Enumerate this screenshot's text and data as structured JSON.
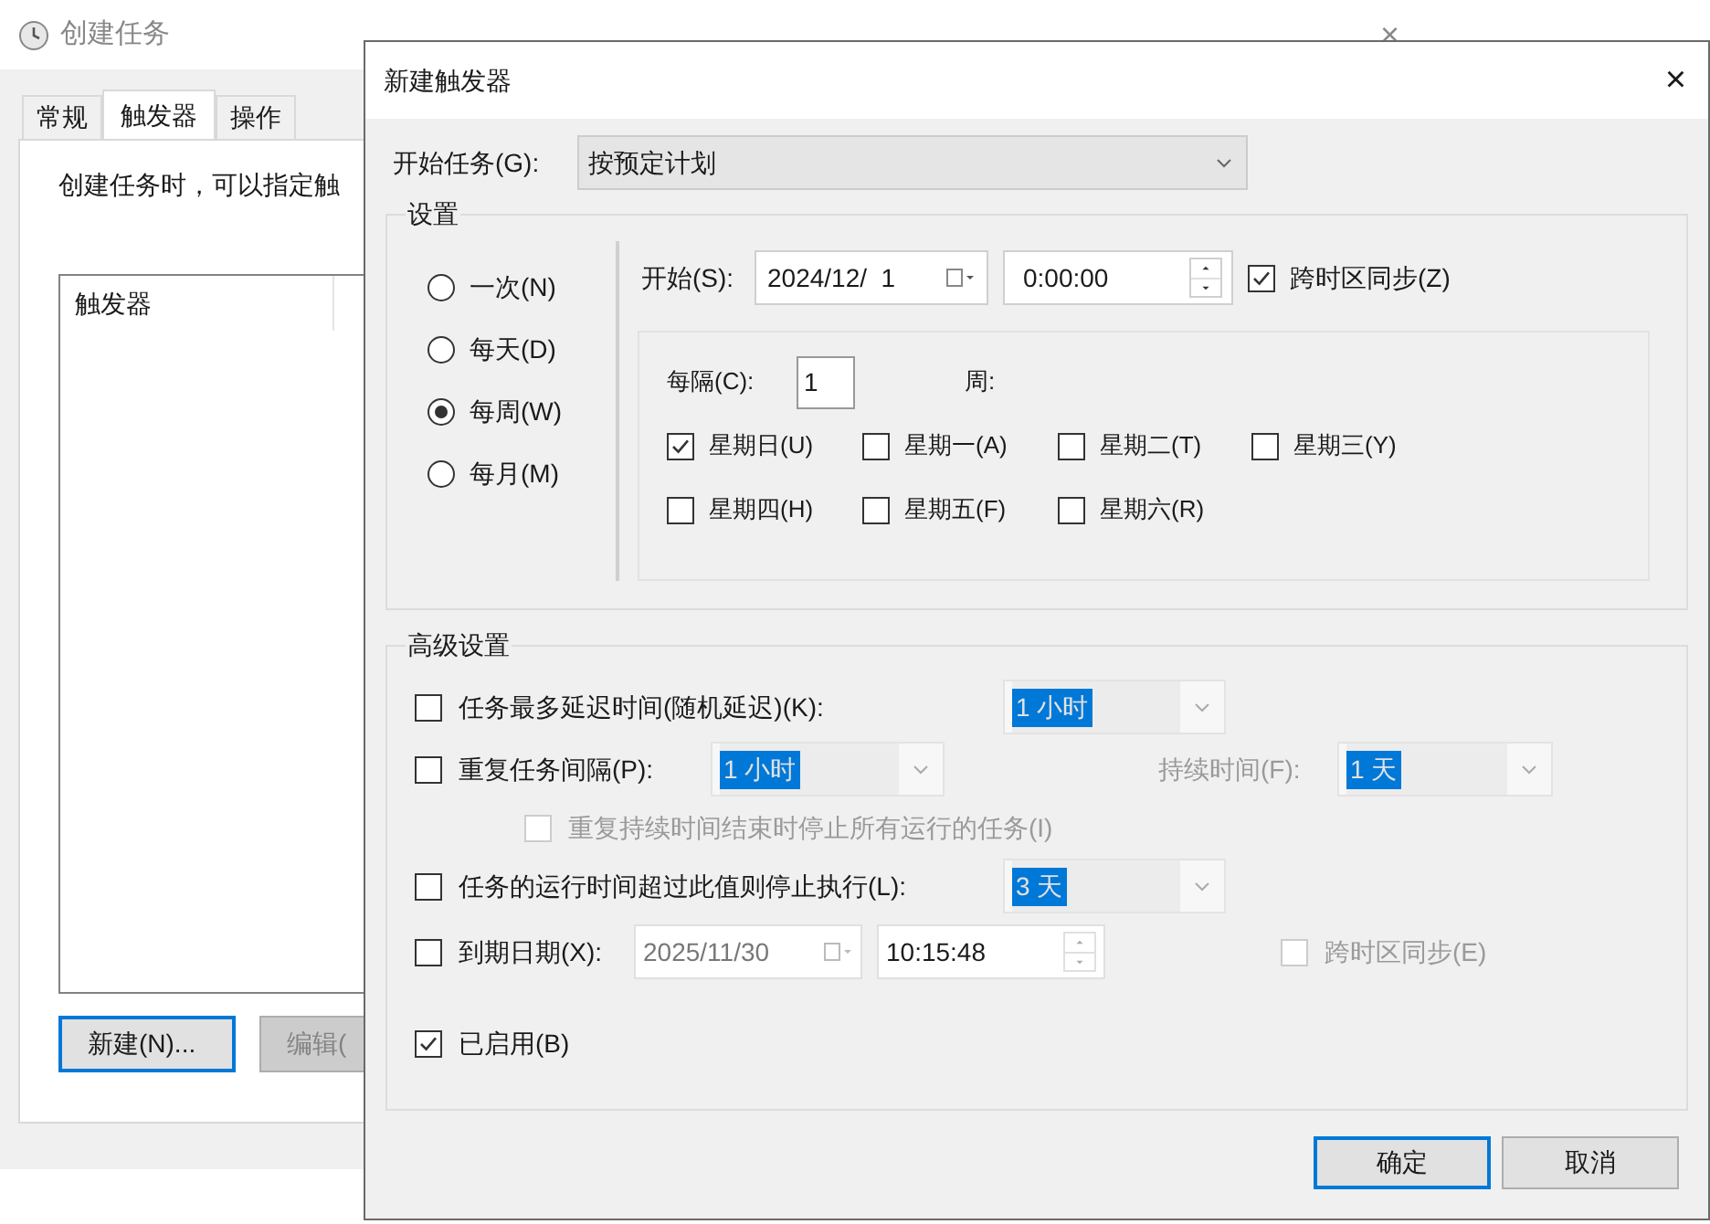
{
  "background_window": {
    "title": "创建任务",
    "close": "×",
    "tabs": [
      {
        "label": "常规",
        "selected": false
      },
      {
        "label": "触发器",
        "selected": true
      },
      {
        "label": "操作",
        "selected": false
      }
    ],
    "description": "创建任务时，可以指定触",
    "table": {
      "columns": [
        "触发器"
      ]
    },
    "buttons": [
      {
        "label": "新建(N)...",
        "disabled": false,
        "focused": true
      },
      {
        "label": "编辑(",
        "disabled": true,
        "focused": false
      }
    ]
  },
  "dialog": {
    "title": "新建触发器",
    "close": "×",
    "start_task": {
      "label": "开始任务(G):",
      "value": "按预定计划"
    },
    "settings": {
      "title": "设置",
      "schedule_options": [
        {
          "label": "一次(N)",
          "selected": false
        },
        {
          "label": "每天(D)",
          "selected": false
        },
        {
          "label": "每周(W)",
          "selected": true
        },
        {
          "label": "每月(M)",
          "selected": false
        }
      ],
      "start": {
        "label": "开始(S):",
        "date": "2024/12/  1",
        "time": "0:00:00",
        "sync": {
          "label": "跨时区同步(Z)",
          "checked": true
        }
      },
      "recur": {
        "label": "每隔(C):",
        "value": "1",
        "unit": "周:"
      },
      "days": [
        {
          "label": "星期日(U)",
          "checked": true
        },
        {
          "label": "星期一(A)",
          "checked": false
        },
        {
          "label": "星期二(T)",
          "checked": false
        },
        {
          "label": "星期三(Y)",
          "checked": false
        },
        {
          "label": "星期四(H)",
          "checked": false
        },
        {
          "label": "星期五(F)",
          "checked": false
        },
        {
          "label": "星期六(R)",
          "checked": false
        }
      ]
    },
    "advanced": {
      "title": "高级设置",
      "rows": [
        {
          "kind": "select",
          "label": "任务最多延迟时间(随机延迟)(K):",
          "checked": false,
          "value": "1 小时",
          "disabled": true
        },
        {
          "kind": "repeat",
          "label": "重复任务间隔(P):",
          "checked": false,
          "value": "1 小时",
          "disabled": true,
          "duration": {
            "label": "持续时间(F):",
            "value": "1 天"
          }
        },
        {
          "kind": "sub",
          "label": "重复持续时间结束时停止所有运行的任务(I)",
          "checked": false,
          "disabled": true
        },
        {
          "kind": "select",
          "label": "任务的运行时间超过此值则停止执行(L):",
          "checked": false,
          "value": "3 天",
          "disabled": true
        },
        {
          "kind": "expire",
          "label": "到期日期(X):",
          "checked": false,
          "disabled": true,
          "date": "2025/11/30",
          "time": "10:15:48",
          "sync": {
            "label": "跨时区同步(E)",
            "checked": false
          }
        },
        {
          "kind": "check",
          "label": "已启用(B)",
          "checked": true,
          "disabled": false
        }
      ]
    },
    "buttons": [
      {
        "label": "确定",
        "default": true
      },
      {
        "label": "取消",
        "default": false
      }
    ]
  }
}
